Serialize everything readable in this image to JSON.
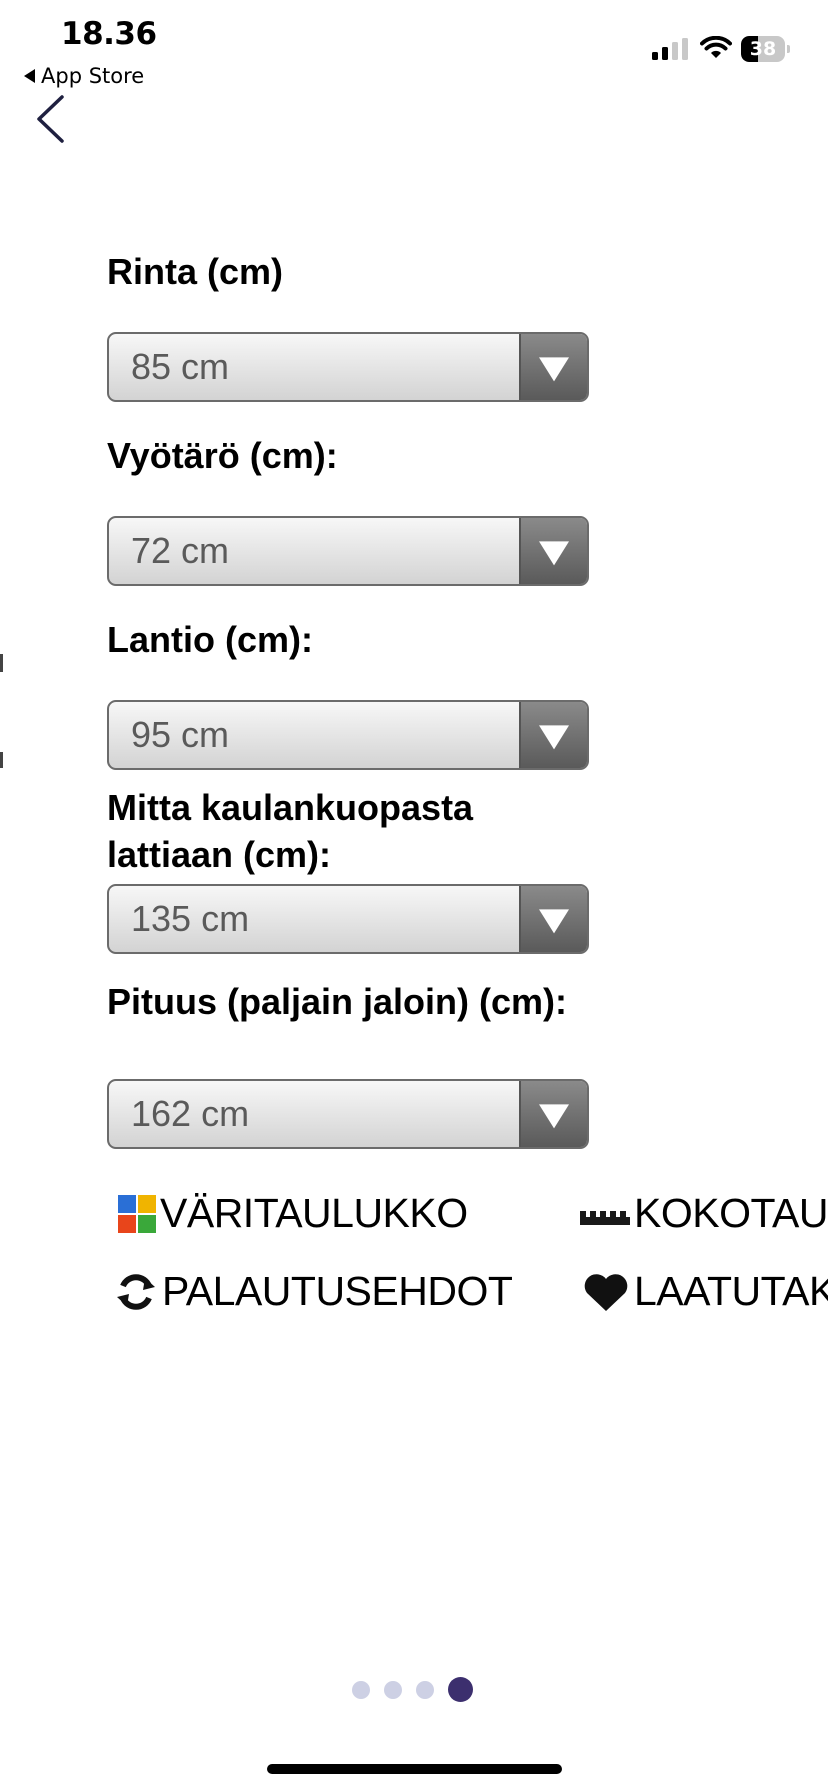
{
  "status_bar": {
    "time": "18.36",
    "back_app": "App Store",
    "battery": 38
  },
  "nav": {
    "back_icon": "chevron-left-icon"
  },
  "form": {
    "fields": [
      {
        "label": "Rinta (cm)",
        "value": "85 cm"
      },
      {
        "label": "Vyötärö (cm):",
        "value": "72 cm"
      },
      {
        "label": "Lantio (cm):",
        "value": "95 cm"
      },
      {
        "label_line1": "Mitta kaulankuopasta",
        "label_line2": "lattiaan (cm):",
        "value": "135 cm"
      },
      {
        "label": "Pituus (paljain jaloin) (cm):",
        "value": "162 cm"
      }
    ]
  },
  "links": {
    "color_chart": {
      "label": "VÄRITAULUKKO",
      "icon": "color-grid-icon"
    },
    "size_chart": {
      "label": "KOKOTAU",
      "icon": "ruler-icon"
    },
    "returns": {
      "label": "PALAUTUSEHDOT",
      "icon": "refresh-arrows-icon"
    },
    "quality": {
      "label": "LAATUTAK",
      "icon": "heart-icon"
    }
  },
  "pager": {
    "count": 4,
    "active_index": 3
  },
  "colors": {
    "active_dot": "#3c2f6e",
    "inactive_dot": "#cdd0e4",
    "color_chart_tiles": [
      "#2a6fd6",
      "#f0b400",
      "#e8451b",
      "#3aa83a"
    ]
  }
}
